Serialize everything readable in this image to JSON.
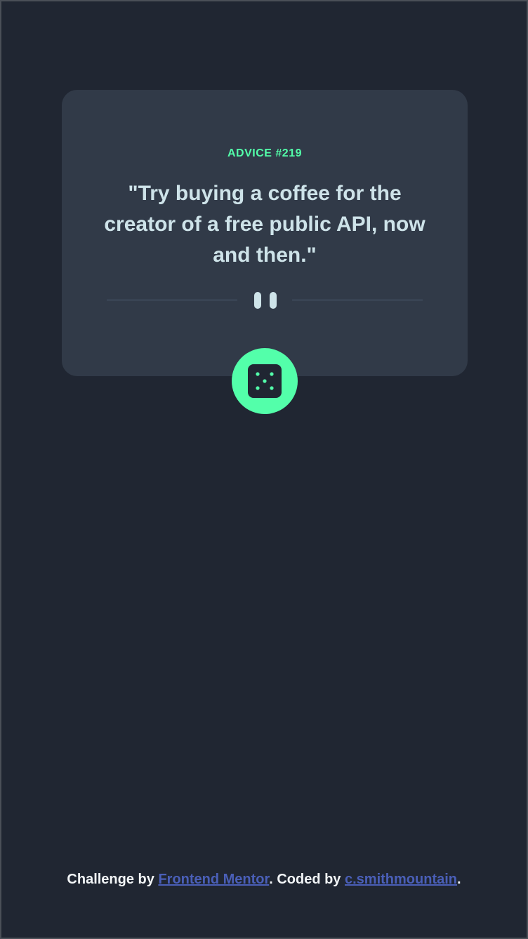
{
  "card": {
    "advice_id": "ADVICE #219",
    "quote": "\"Try buying a coffee for the creator of a free public API, now and then.\""
  },
  "dice_button": {
    "icon": "dice-icon"
  },
  "footer": {
    "prefix": "Challenge by ",
    "link1": "Frontend Mentor",
    "middle": ". Coded by ",
    "link2": "c.smithmountain",
    "suffix": "."
  },
  "colors": {
    "background": "#202632",
    "card": "#313a48",
    "accent": "#53ffaa",
    "text": "#cee3e9",
    "link": "#4a5fb8"
  }
}
